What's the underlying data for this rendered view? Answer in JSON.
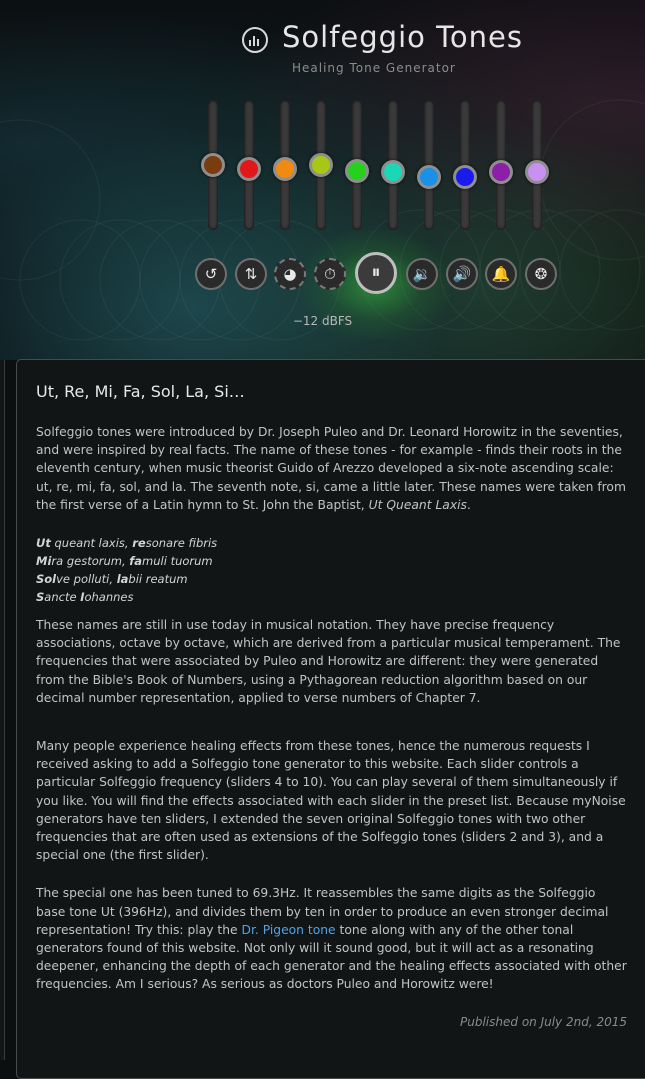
{
  "header": {
    "title": "Solfeggio Tones",
    "subtitle": "Healing Tone Generator",
    "logo_icon": "equalizer-icon"
  },
  "sliders": [
    {
      "color": "#7a3c0e",
      "level": 0.66
    },
    {
      "color": "#e01818",
      "level": 0.62
    },
    {
      "color": "#f08a10",
      "level": 0.62
    },
    {
      "color": "#a6c814",
      "level": 0.66
    },
    {
      "color": "#28d01e",
      "level": 0.6
    },
    {
      "color": "#18d8b8",
      "level": 0.59
    },
    {
      "color": "#1a90e6",
      "level": 0.55
    },
    {
      "color": "#1a1aee",
      "level": 0.55
    },
    {
      "color": "#8c1ea8",
      "level": 0.59
    },
    {
      "color": "#c890f0",
      "level": 0.59
    }
  ],
  "controls": [
    {
      "name": "reset-icon",
      "glyph": "↺"
    },
    {
      "name": "shuffle-sliders-icon",
      "glyph": "⇅"
    },
    {
      "name": "animate-icon",
      "glyph": "◕"
    },
    {
      "name": "timer-icon",
      "glyph": "⏱"
    },
    {
      "name": "pause-icon",
      "glyph": "⏸"
    },
    {
      "name": "volume-down-icon",
      "glyph": "🔉"
    },
    {
      "name": "volume-up-icon",
      "glyph": "🔊"
    },
    {
      "name": "alarm-bell-icon",
      "glyph": "🔔"
    },
    {
      "name": "brain-icon",
      "glyph": "❂"
    }
  ],
  "level_readout": "−12 dBFS",
  "article": {
    "heading": "Ut, Re, Mi, Fa, Sol, La, Si…",
    "p1": "Solfeggio tones were introduced by Dr. Joseph Puleo and Dr. Leonard Horowitz in the seventies, and were inspired by real facts. The name of these tones - for example - finds their roots in the eleventh century, when music theorist Guido of Arezzo developed a six-note ascending scale: ut, re, mi, fa, sol, and la. The seventh note, si, came a little later. These names were taken from the first verse of a Latin hymn to St. John the Baptist,",
    "p1_italic": "Ut Queant Laxis",
    "p1_end": ".",
    "poem": [
      {
        "b": "Ut",
        "rest": " queant laxis, ",
        "b2": "re",
        "rest2": "sonare fibris"
      },
      {
        "b": "Mi",
        "rest": "ra gestorum, ",
        "b2": "fa",
        "rest2": "muli tuorum"
      },
      {
        "b": "Sol",
        "rest": "ve polluti, ",
        "b2": "la",
        "rest2": "bii reatum"
      },
      {
        "b": "S",
        "rest": "ancte ",
        "b2": "I",
        "rest2": "ohannes"
      }
    ],
    "p2": "These names are still in use today in musical notation. They have precise frequency associations, octave by octave, which are derived from a particular musical temperament. The frequencies that were associated by Puleo and Horowitz are different: they were generated from the Bible's Book of Numbers, using a Pythagorean reduction algorithm based on our decimal number representation, applied to verse numbers of Chapter 7.",
    "p3": "Many people experience healing effects from these tones, hence the numerous requests I received asking to add a Solfeggio tone generator to this website. Each slider controls a particular Solfeggio frequency (sliders 4 to 10). You can play several of them simultaneously if you like. You will find the effects associated with each slider in the preset list. Because myNoise generators have ten sliders, I extended the seven original Solfeggio tones with two other frequencies that are often used as extensions of the Solfeggio tones (sliders 2 and 3), and a special one (the first slider).",
    "p4_a": "The special one has been tuned to 69.3Hz. It reassembles the same digits as the Solfeggio base tone Ut (396Hz), and divides them by ten in order to produce an even stronger decimal representation! Try this: play the",
    "p4_link": "Dr. Pigeon tone",
    "p4_b": "tone along with any of the other tonal generators found of this website. Not only will it sound good, but it will act as a resonating deepener, enhancing the depth of each generator and the healing effects associated with other frequencies. Am I serious? As serious as doctors Puleo and Horowitz were!",
    "published": "Published on July 2nd, 2015"
  }
}
